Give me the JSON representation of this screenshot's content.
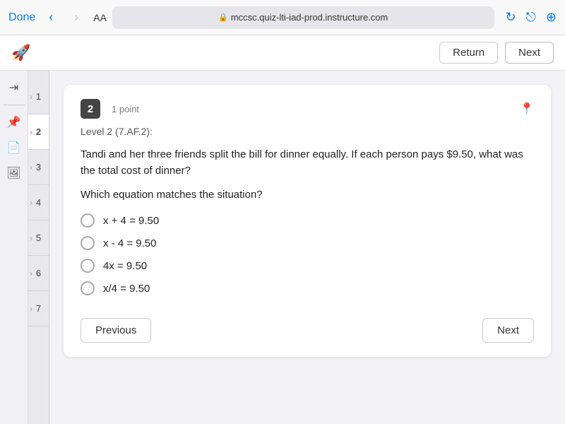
{
  "browser": {
    "done_label": "Done",
    "aa_label": "AA",
    "url": "mccsc.quiz-lti-iad-prod.instructure.com",
    "back_disabled": false,
    "forward_disabled": true
  },
  "toolbar": {
    "logo_icon": "🚀",
    "return_label": "Return",
    "next_label": "Next"
  },
  "sidebar": {
    "icons": [
      {
        "name": "tab-icon",
        "glyph": "⇥"
      },
      {
        "name": "pin-sidebar-icon",
        "glyph": "📌"
      },
      {
        "name": "page-icon",
        "glyph": "📄"
      },
      {
        "name": "image-icon",
        "glyph": "🖼"
      }
    ]
  },
  "question_nav": {
    "items": [
      {
        "number": "1",
        "active": false
      },
      {
        "number": "2",
        "active": true
      },
      {
        "number": "3",
        "active": false
      },
      {
        "number": "4",
        "active": false
      },
      {
        "number": "5",
        "active": false
      },
      {
        "number": "6",
        "active": false
      },
      {
        "number": "7",
        "active": false
      }
    ]
  },
  "question": {
    "number": "2",
    "points": "1 point",
    "level": "Level 2 (7.AF.2):",
    "text": "Tandi and her three friends split the bill for dinner equally.  If each person pays $9.50, what was the total cost of dinner?",
    "prompt": "Which equation matches the situation?",
    "options": [
      {
        "id": "A",
        "text": "x + 4 = 9.50"
      },
      {
        "id": "B",
        "text": "x - 4 = 9.50"
      },
      {
        "id": "C",
        "text": "4x = 9.50"
      },
      {
        "id": "D",
        "text": "x/4 = 9.50"
      }
    ],
    "previous_label": "Previous",
    "next_label": "Next"
  }
}
